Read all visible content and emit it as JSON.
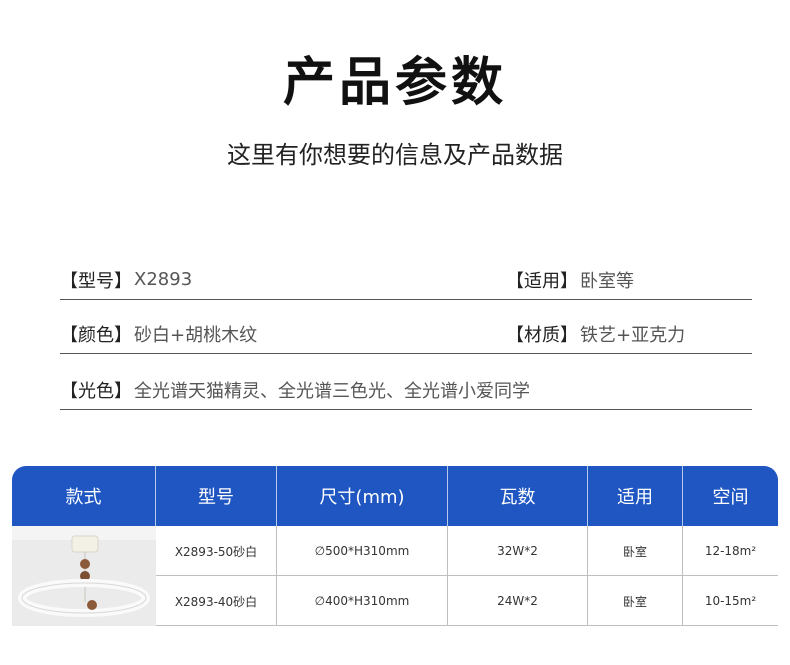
{
  "header": {
    "title": "产品参数",
    "subtitle": "这里有你想要的信息及产品数据"
  },
  "specs": [
    {
      "key": "【型号】",
      "value": "X2893"
    },
    {
      "key": "【适用】",
      "value": "卧室等"
    },
    {
      "key": "【颜色】",
      "value": "砂白+胡桃木纹"
    },
    {
      "key": "【材质】",
      "value": "铁艺+亚克力"
    },
    {
      "key": "【光色】",
      "value": "全光谱天猫精灵、全光谱三色光、全光谱小爱同学"
    }
  ],
  "table": {
    "headers": [
      "款式",
      "型号",
      "尺寸(mm)",
      "瓦数",
      "适用",
      "空间"
    ],
    "rows": [
      {
        "model": "X2893-50砂白",
        "size": "∅500*H310mm",
        "watt": "32W*2",
        "use": "卧室",
        "space": "12-18m²"
      },
      {
        "model": "X2893-40砂白",
        "size": "∅400*H310mm",
        "watt": "24W*2",
        "use": "卧室",
        "space": "10-15m²"
      }
    ]
  },
  "colors": {
    "header_blue": "#1f56c2"
  }
}
